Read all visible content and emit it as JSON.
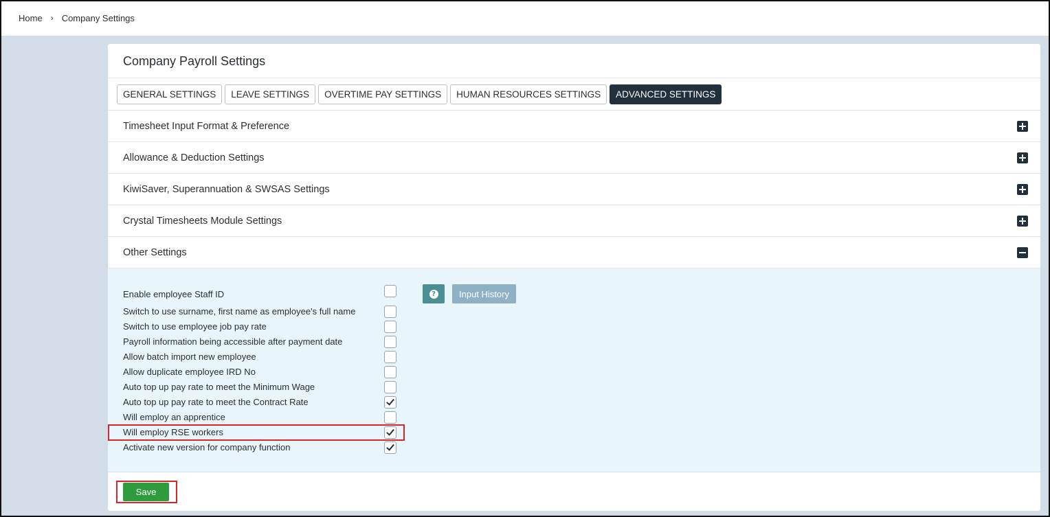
{
  "breadcrumb": {
    "home": "Home",
    "separator": "›",
    "current": "Company Settings"
  },
  "page_title": "Company Payroll Settings",
  "tabs": [
    {
      "label": "GENERAL SETTINGS",
      "active": false
    },
    {
      "label": "LEAVE SETTINGS",
      "active": false
    },
    {
      "label": "OVERTIME PAY SETTINGS",
      "active": false
    },
    {
      "label": "HUMAN RESOURCES SETTINGS",
      "active": false
    },
    {
      "label": "ADVANCED SETTINGS",
      "active": true
    }
  ],
  "sections": [
    {
      "title": "Timesheet Input Format & Preference",
      "expanded": false,
      "icon": "plus-square-icon"
    },
    {
      "title": "Allowance & Deduction Settings",
      "expanded": false,
      "icon": "plus-square-icon"
    },
    {
      "title": "KiwiSaver, Superannuation & SWSAS Settings",
      "expanded": false,
      "icon": "plus-square-icon"
    },
    {
      "title": "Crystal Timesheets Module Settings",
      "expanded": false,
      "icon": "plus-square-icon"
    },
    {
      "title": "Other Settings",
      "expanded": true,
      "icon": "minus-square-icon"
    }
  ],
  "other_settings": {
    "options": [
      {
        "label": "Enable employee Staff ID",
        "checked": false
      },
      {
        "label": "Switch to use surname, first name as employee's full name",
        "checked": false
      },
      {
        "label": "Switch to use employee job pay rate",
        "checked": false
      },
      {
        "label": "Payroll information being accessible after payment date",
        "checked": false
      },
      {
        "label": "Allow batch import new employee",
        "checked": false
      },
      {
        "label": "Allow duplicate employee IRD No",
        "checked": false
      },
      {
        "label": "Auto top up pay rate to meet the Minimum Wage",
        "checked": false
      },
      {
        "label": "Auto top up pay rate to meet the Contract Rate",
        "checked": true
      },
      {
        "label": "Will employ an apprentice",
        "checked": false
      },
      {
        "label": "Will employ RSE workers",
        "checked": true
      },
      {
        "label": "Activate new version for company function",
        "checked": true
      }
    ],
    "help_icon": "question-circle-icon",
    "input_history_label": "Input History"
  },
  "save_label": "Save",
  "colors": {
    "page_bg": "#d2dde8",
    "dark_navy": "#22303d",
    "panel_bg": "#e8f5fb",
    "help_teal": "#4a8f94",
    "history_blue": "#8fb1c6",
    "save_green": "#2e9b3c",
    "highlight_red": "#d6262c"
  }
}
